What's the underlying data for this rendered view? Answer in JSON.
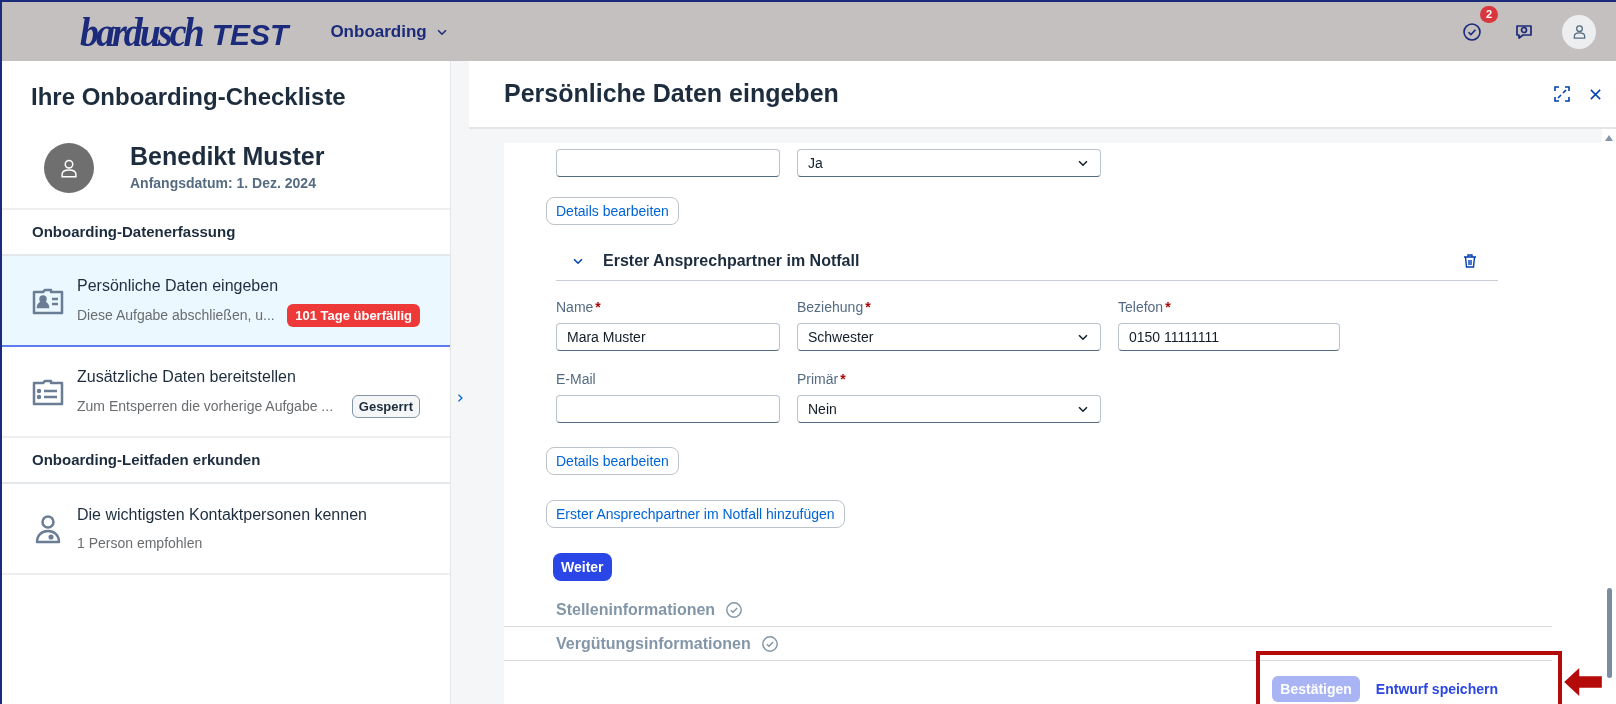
{
  "header": {
    "logo_text": "bardusch",
    "logo_suffix": "TEST",
    "menu": "Onboarding",
    "notifications_badge": "2"
  },
  "sidebar": {
    "title": "Ihre Onboarding-Checkliste",
    "person": {
      "name": "Benedikt Muster",
      "start_date": "Anfangsdatum: 1. Dez. 2024"
    },
    "groups": [
      {
        "title": "Onboarding-Datenerfassung",
        "items": [
          {
            "kind": "card",
            "title": "Persönliche Daten eingeben",
            "subtitle": "Diese Aufgabe abschließen, u...",
            "badge": {
              "kind": "overdue",
              "text": "101 Tage überfällig"
            },
            "selected": true
          },
          {
            "kind": "list",
            "title": "Zusätzliche Daten bereitstellen",
            "subtitle": "Zum Entsperren die vorherige Aufgabe ...",
            "badge": {
              "kind": "locked",
              "text": "Gesperrt"
            },
            "selected": false
          }
        ]
      },
      {
        "title": "Onboarding-Leitfaden erkunden",
        "items": [
          {
            "kind": "person",
            "title": "Die wichtigsten Kontaktpersonen kennen",
            "subtitle": "1 Person empfohlen",
            "selected": false
          }
        ]
      }
    ]
  },
  "panel": {
    "title": "Persönliche Daten eingeben",
    "top_row": [
      {
        "kind": "input"
      },
      {
        "kind": "select",
        "value": "Ja"
      }
    ],
    "edit_button": "Details bearbeiten",
    "section": {
      "title": "Erster Ansprechpartner im Notfall",
      "expanded": true,
      "rows": [
        [
          {
            "label": "Name",
            "required_mark": "*",
            "kind": "input",
            "value": "Mara Muster"
          },
          {
            "label": "Beziehung",
            "required_mark": "*",
            "kind": "select",
            "value": "Schwester"
          },
          {
            "label": "Telefon",
            "required_mark": "*",
            "kind": "input",
            "value": "0150 11111111"
          }
        ],
        [
          {
            "label": "E-Mail",
            "kind": "input"
          },
          {
            "label": "Primär",
            "required_mark": "*",
            "kind": "select",
            "value": "Nein"
          }
        ]
      ],
      "edit_button": "Details bearbeiten"
    },
    "add_button": "Erster Ansprechpartner im Notfall hinzufügen",
    "next_button": "Weiter",
    "steps": [
      {
        "title": "Stelleninformationen",
        "completed": true
      },
      {
        "title": "Vergütungsinformationen",
        "completed": true
      }
    ],
    "footer": {
      "confirm": {
        "label": "Bestätigen",
        "disabled": true
      },
      "save_draft": "Entwurf speichern"
    }
  }
}
